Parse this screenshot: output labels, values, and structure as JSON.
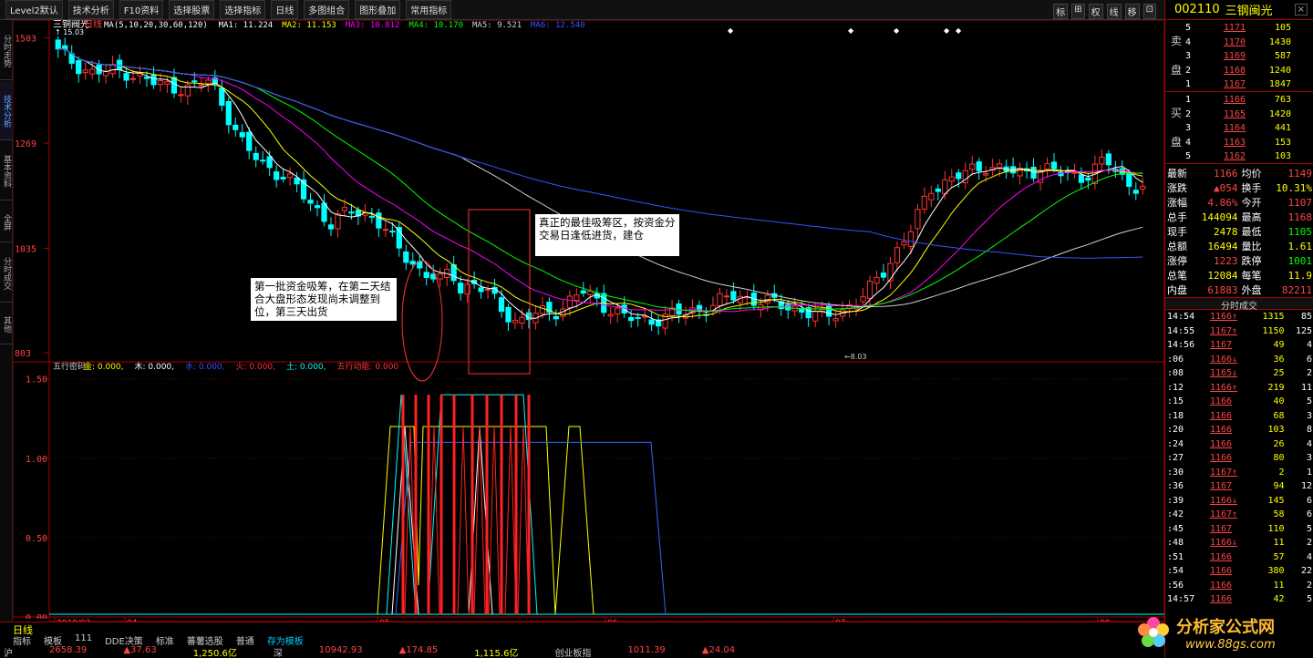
{
  "menu": {
    "items": [
      "Level2默认",
      "技术分析",
      "F10资料",
      "选择股票",
      "选择指标",
      "日线",
      "多图组合",
      "图形叠加",
      "常用指标"
    ],
    "right_tools": [
      "标",
      "⊞",
      "权",
      "线",
      "移",
      "⊡"
    ]
  },
  "leftnav": {
    "tabs": [
      "分时走势",
      "技术分析",
      "基本资料",
      "全屏",
      "分时成交",
      "其他"
    ],
    "active": 1
  },
  "chart": {
    "title": "三铜阀光",
    "period": "日线",
    "hi_label": "15.03",
    "ma_legend": [
      {
        "t": "MA(5,10,20,30,60,120)",
        "c": "#ffffff"
      },
      {
        "t": "MA1: 11.224",
        "c": "#ffffff"
      },
      {
        "t": "MA2: 11.153",
        "c": "#ffff00"
      },
      {
        "t": "MA3: 10.812",
        "c": "#ff00ff"
      },
      {
        "t": "MA4: 10.170",
        "c": "#00ff00"
      },
      {
        "t": "MA5: 9.521",
        "c": "#d0d0d0"
      },
      {
        "t": "MA6: 12.540",
        "c": "#3355ff"
      }
    ],
    "price_axis": [
      "1503",
      "1269",
      "1035",
      "803"
    ],
    "lower_axis": [
      "1.50",
      "1.00",
      "0.50",
      "0.00"
    ],
    "indicator_legend": [
      {
        "t": "五行密码",
        "c": "#cccccc"
      },
      {
        "t": "金: 0.000,",
        "c": "#ffff00"
      },
      {
        "t": "木: 0.000,",
        "c": "#ffffff"
      },
      {
        "t": "水: 0.000,",
        "c": "#3355ff"
      },
      {
        "t": "火: 0.000,",
        "c": "#ff3333"
      },
      {
        "t": "土: 0.000,",
        "c": "#00ffff"
      },
      {
        "t": "五行动能: 0.000",
        "c": "#ff3333"
      }
    ],
    "low_marker": "←8.03",
    "date_axis": [
      "2010/03",
      "04",
      "05",
      "06",
      "07",
      "08"
    ],
    "annotation1": "第一批资金吸筹，在第二天结合大盘形态发现尚未调整到位，第三天出货",
    "annotation2": "真正的最佳吸筹区，按资金分交易日逢低进货，建仓"
  },
  "quote": {
    "code": "002110",
    "name": "三钢闽光",
    "sell": [
      {
        "lvl": "5",
        "price": "1171",
        "vol": "105"
      },
      {
        "lvl": "4",
        "price": "1170",
        "vol": "1430"
      },
      {
        "lvl": "3",
        "price": "1169",
        "vol": "587"
      },
      {
        "lvl": "2",
        "price": "1168",
        "vol": "1240"
      },
      {
        "lvl": "1",
        "price": "1167",
        "vol": "1847"
      }
    ],
    "buy": [
      {
        "lvl": "1",
        "price": "1166",
        "vol": "763"
      },
      {
        "lvl": "2",
        "price": "1165",
        "vol": "1420"
      },
      {
        "lvl": "3",
        "price": "1164",
        "vol": "441"
      },
      {
        "lvl": "4",
        "price": "1163",
        "vol": "153"
      },
      {
        "lvl": "5",
        "price": "1162",
        "vol": "103"
      }
    ],
    "sell_label": [
      "卖",
      "盘"
    ],
    "buy_label": [
      "买",
      "盘"
    ],
    "stats": [
      {
        "k1": "最新",
        "v1": "1166",
        "k2": "均价",
        "v2": "1149"
      },
      {
        "k1": "涨跌",
        "v1": "▲054",
        "k2": "换手",
        "v2": "10.31%"
      },
      {
        "k1": "涨幅",
        "v1": "4.86%",
        "k2": "今开",
        "v2": "1107"
      },
      {
        "k1": "总手",
        "v1": "144094",
        "k2": "最高",
        "v2": "1168"
      },
      {
        "k1": "现手",
        "v1": "2478",
        "k2": "最低",
        "v2": "1105"
      },
      {
        "k1": "总额",
        "v1": "16494",
        "k2": "量比",
        "v2": "1.61"
      },
      {
        "k1": "涨停",
        "v1": "1223",
        "k2": "跌停",
        "v2": "1001"
      },
      {
        "k1": "总笔",
        "v1": "12084",
        "k2": "每笔",
        "v2": "11.9"
      },
      {
        "k1": "内盘",
        "v1": "61883",
        "k2": "外盘",
        "v2": "82211"
      }
    ],
    "trades_title": "分时成交",
    "trades": [
      {
        "t": "14:54",
        "p": "1166↑",
        "v": "1315",
        "n": "85"
      },
      {
        "t": "14:55",
        "p": "1167↑",
        "v": "1150",
        "n": "125"
      },
      {
        "t": "14:56",
        "p": "1167",
        "v": "49",
        "n": "4"
      },
      {
        "t": ":06",
        "p": "1166↓",
        "v": "36",
        "n": "6"
      },
      {
        "t": ":08",
        "p": "1165↓",
        "v": "25",
        "n": "2"
      },
      {
        "t": ":12",
        "p": "1166↑",
        "v": "219",
        "n": "11"
      },
      {
        "t": ":15",
        "p": "1166",
        "v": "40",
        "n": "5"
      },
      {
        "t": ":18",
        "p": "1166",
        "v": "68",
        "n": "3"
      },
      {
        "t": ":20",
        "p": "1166",
        "v": "103",
        "n": "8"
      },
      {
        "t": ":24",
        "p": "1166",
        "v": "26",
        "n": "4"
      },
      {
        "t": ":27",
        "p": "1166",
        "v": "80",
        "n": "3"
      },
      {
        "t": ":30",
        "p": "1167↑",
        "v": "2",
        "n": "1"
      },
      {
        "t": ":36",
        "p": "1167",
        "v": "94",
        "n": "12"
      },
      {
        "t": ":39",
        "p": "1166↓",
        "v": "145",
        "n": "6"
      },
      {
        "t": ":42",
        "p": "1167↑",
        "v": "58",
        "n": "6"
      },
      {
        "t": ":45",
        "p": "1167",
        "v": "110",
        "n": "5"
      },
      {
        "t": ":48",
        "p": "1166↓",
        "v": "11",
        "n": "2"
      },
      {
        "t": ":51",
        "p": "1166",
        "v": "57",
        "n": "4"
      },
      {
        "t": ":54",
        "p": "1166",
        "v": "380",
        "n": "22"
      },
      {
        "t": ":56",
        "p": "1166",
        "v": "11",
        "n": "2"
      },
      {
        "t": "14:57",
        "p": "1166",
        "v": "42",
        "n": "5"
      }
    ]
  },
  "bottom": {
    "period_label": "日线",
    "tabs": [
      "指标",
      "模板",
      "111",
      "DDE决策",
      "标准",
      "蕃薯选股",
      "普通",
      "存为模板"
    ],
    "active_tab": 7,
    "status": [
      {
        "t": "沪",
        "c": "#ccc"
      },
      {
        "t": "2658.39",
        "c": "#f44"
      },
      {
        "t": "▲37.63",
        "c": "#f44"
      },
      {
        "t": "1,250.6亿",
        "c": "#ff0"
      },
      {
        "t": "深",
        "c": "#ccc"
      },
      {
        "t": "10942.93",
        "c": "#f44"
      },
      {
        "t": "▲174.85",
        "c": "#f44"
      },
      {
        "t": "1,115.6亿",
        "c": "#ff0"
      },
      {
        "t": "创业板指",
        "c": "#ccc"
      },
      {
        "t": "1011.39",
        "c": "#f44"
      },
      {
        "t": "▲24.04",
        "c": "#f44"
      }
    ]
  },
  "logo": {
    "text": "分析家公式网",
    "url": "www.88gs.com"
  }
}
